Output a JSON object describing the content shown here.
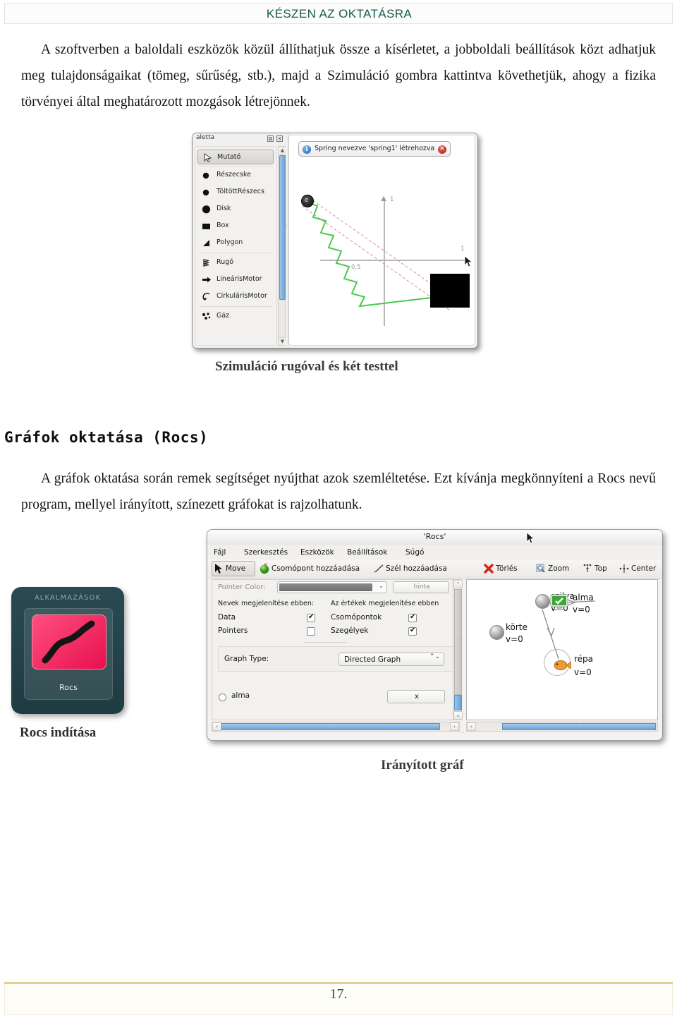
{
  "header": {
    "title": "KÉSZEN AZ OKTATÁSRA"
  },
  "footer": {
    "page_number": "17."
  },
  "body": {
    "paragraph_1": "A szoftverben a baloldali eszközök közül állíthatjuk össze a kísérletet, a jobboldali beállítások közt adhatjuk meg tulajdonságaikat (tömeg, sűrűség, stb.), majd a Szimuláció gombra kattintva követhetjük, ahogy a fizika törvényei által meghatározott mozgások létrejönnek.",
    "section_heading": "Gráfok oktatása (Rocs)",
    "paragraph_2": "A gráfok oktatása során remek segítséget nyújthat azok szemléltetése. Ezt kívánja megkönnyíteni a Rocs nevű program, mellyel irányított, színezett gráfokat is rajzolhatunk."
  },
  "captions": {
    "simulation": "Szimuláció rugóval és két testtel",
    "launcher": "Rocs indítása",
    "graph": "Irányított gráf"
  },
  "step_figure": {
    "palette_title": "aletta",
    "palette_undock": "⧉",
    "palette_close": "✕",
    "scroll_up": "▲",
    "scroll_down": "▼",
    "splitter_grip": "⋮",
    "items": [
      {
        "label": "Mutató",
        "icon": "cursor-icon",
        "selected": true
      },
      {
        "label": "Részecske",
        "icon": "particle-icon",
        "selected": false
      },
      {
        "label": "TöltöttRészecs",
        "icon": "charged-particle-icon",
        "selected": false
      },
      {
        "label": "Disk",
        "icon": "disk-icon",
        "selected": false
      },
      {
        "label": "Box",
        "icon": "box-icon",
        "selected": false
      },
      {
        "label": "Polygon",
        "icon": "polygon-icon",
        "selected": false
      },
      {
        "label": "Rugó",
        "icon": "spring-icon",
        "selected": false
      },
      {
        "label": "LineárisMotor",
        "icon": "linear-motor-icon",
        "selected": false
      },
      {
        "label": "CirkulárisMotor",
        "icon": "circular-motor-icon",
        "selected": false
      },
      {
        "label": "Gáz",
        "icon": "gas-icon",
        "selected": false
      }
    ],
    "notification": {
      "icon": "info-icon",
      "icon_glyph": "i",
      "text": "Spring nevezve 'spring1' létrehozva",
      "close_glyph": "✕"
    },
    "canvas": {
      "y_axis_label": "1",
      "x_axis_label": "1",
      "half_label": "0,5",
      "ball_glyph": "e",
      "spring_color": "#4cc94c",
      "guide_color": "#d98f8f",
      "box_color": "#000000"
    }
  },
  "launcher": {
    "group_label": "ALKALMAZÁSOK",
    "app_label": "Rocs",
    "icon_name": "rocs-curve-icon",
    "tile_color": "#e8104f",
    "panel_color": "#2a4a52"
  },
  "rocs": {
    "window_title": "'Rocs'",
    "menus": [
      {
        "label": "Fájl"
      },
      {
        "label": "Szerkesztés"
      },
      {
        "label": "Eszközök"
      },
      {
        "label": "Beállítások"
      },
      {
        "label": "Súgó"
      }
    ],
    "toolbar": [
      {
        "label": "Move",
        "icon": "cursor-arrow-icon",
        "active": true
      },
      {
        "label": "Csomópont hozzáadása",
        "icon": "green-node-icon",
        "active": false
      },
      {
        "label": "Szél hozzáadása",
        "icon": "edge-curve-icon",
        "active": false
      },
      {
        "label": "Törlés",
        "icon": "red-x-icon",
        "active": false
      },
      {
        "label": "Zoom",
        "icon": "magnifier-icon",
        "active": false
      },
      {
        "label": "Top",
        "icon": "align-top-icon",
        "active": false
      },
      {
        "label": "Center",
        "icon": "align-center-icon",
        "active": false
      }
    ],
    "options": {
      "hidden_row_label": "Pointer Color:",
      "hidden_button_label": "hinta",
      "color_dropdown_arrow": "⌄",
      "column_head_names": "Nevek megjelenítése ebben:",
      "column_head_values": "Az értékek megjelenítése ebben",
      "rows": [
        {
          "label": "Data",
          "checked": true
        },
        {
          "label": "Pointers",
          "checked": false
        },
        {
          "label": "Csomópontok",
          "checked": true
        },
        {
          "label": "Szegélyek",
          "checked": true
        }
      ],
      "graph_type_label": "Graph Type:",
      "graph_type_value": "Directed Graph",
      "graph_type_spinner": "⌃⌄",
      "item_radio_label": "alma",
      "close_item_button": "x"
    },
    "graph": {
      "nodes": [
        {
          "name": "szilva",
          "value": "v=0",
          "icon": "grey-sphere-icon"
        },
        {
          "name": "alma",
          "value": "v=0",
          "icon": "green-monitor-icon"
        },
        {
          "name": "körte",
          "value": "v=0",
          "icon": "grey-sphere-icon"
        },
        {
          "name": "répa",
          "value": "v=0",
          "icon": "orange-fish-icon"
        }
      ],
      "edges": [
        {
          "from": "szilva",
          "to": "alma"
        },
        {
          "from": "szilva",
          "to": "répa"
        }
      ]
    },
    "scrollbars": {
      "left_arrow": "‹",
      "right_arrow": "›",
      "up_arrow": "⌃",
      "down_arrow": "⌄",
      "thumb_grip": "⋯"
    }
  }
}
